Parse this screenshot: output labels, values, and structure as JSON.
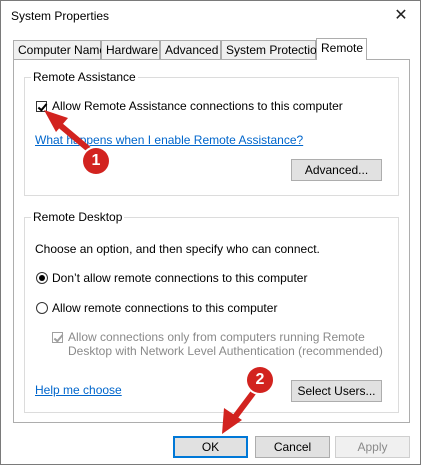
{
  "window": {
    "title": "System Properties",
    "close_glyph": "✕"
  },
  "tabs": [
    {
      "label": "Computer Name"
    },
    {
      "label": "Hardware"
    },
    {
      "label": "Advanced"
    },
    {
      "label": "System Protection"
    },
    {
      "label": "Remote"
    }
  ],
  "active_tab": "Remote",
  "remote_assistance": {
    "group_label": "Remote Assistance",
    "allow_checkbox_label": "Allow Remote Assistance connections to this computer",
    "allow_checked": true,
    "help_link": "What happens when I enable Remote Assistance?",
    "advanced_button": "Advanced..."
  },
  "remote_desktop": {
    "group_label": "Remote Desktop",
    "instruction": "Choose an option, and then specify who can connect.",
    "option_dont_allow": "Don’t allow remote connections to this computer",
    "option_allow": "Allow remote connections to this computer",
    "selected_option": "dont_allow",
    "nla_label_line1": "Allow connections only from computers running Remote",
    "nla_label_line2": "Desktop with Network Level Authentication (recommended)",
    "nla_checked": true,
    "help_link": "Help me choose",
    "select_users_button": "Select Users..."
  },
  "footer": {
    "ok": "OK",
    "cancel": "Cancel",
    "apply": "Apply"
  },
  "annotations": [
    {
      "number": "1"
    },
    {
      "number": "2"
    }
  ],
  "colors": {
    "accent": "#0078d7",
    "link": "#0066cc",
    "annotation": "#d2231f"
  }
}
